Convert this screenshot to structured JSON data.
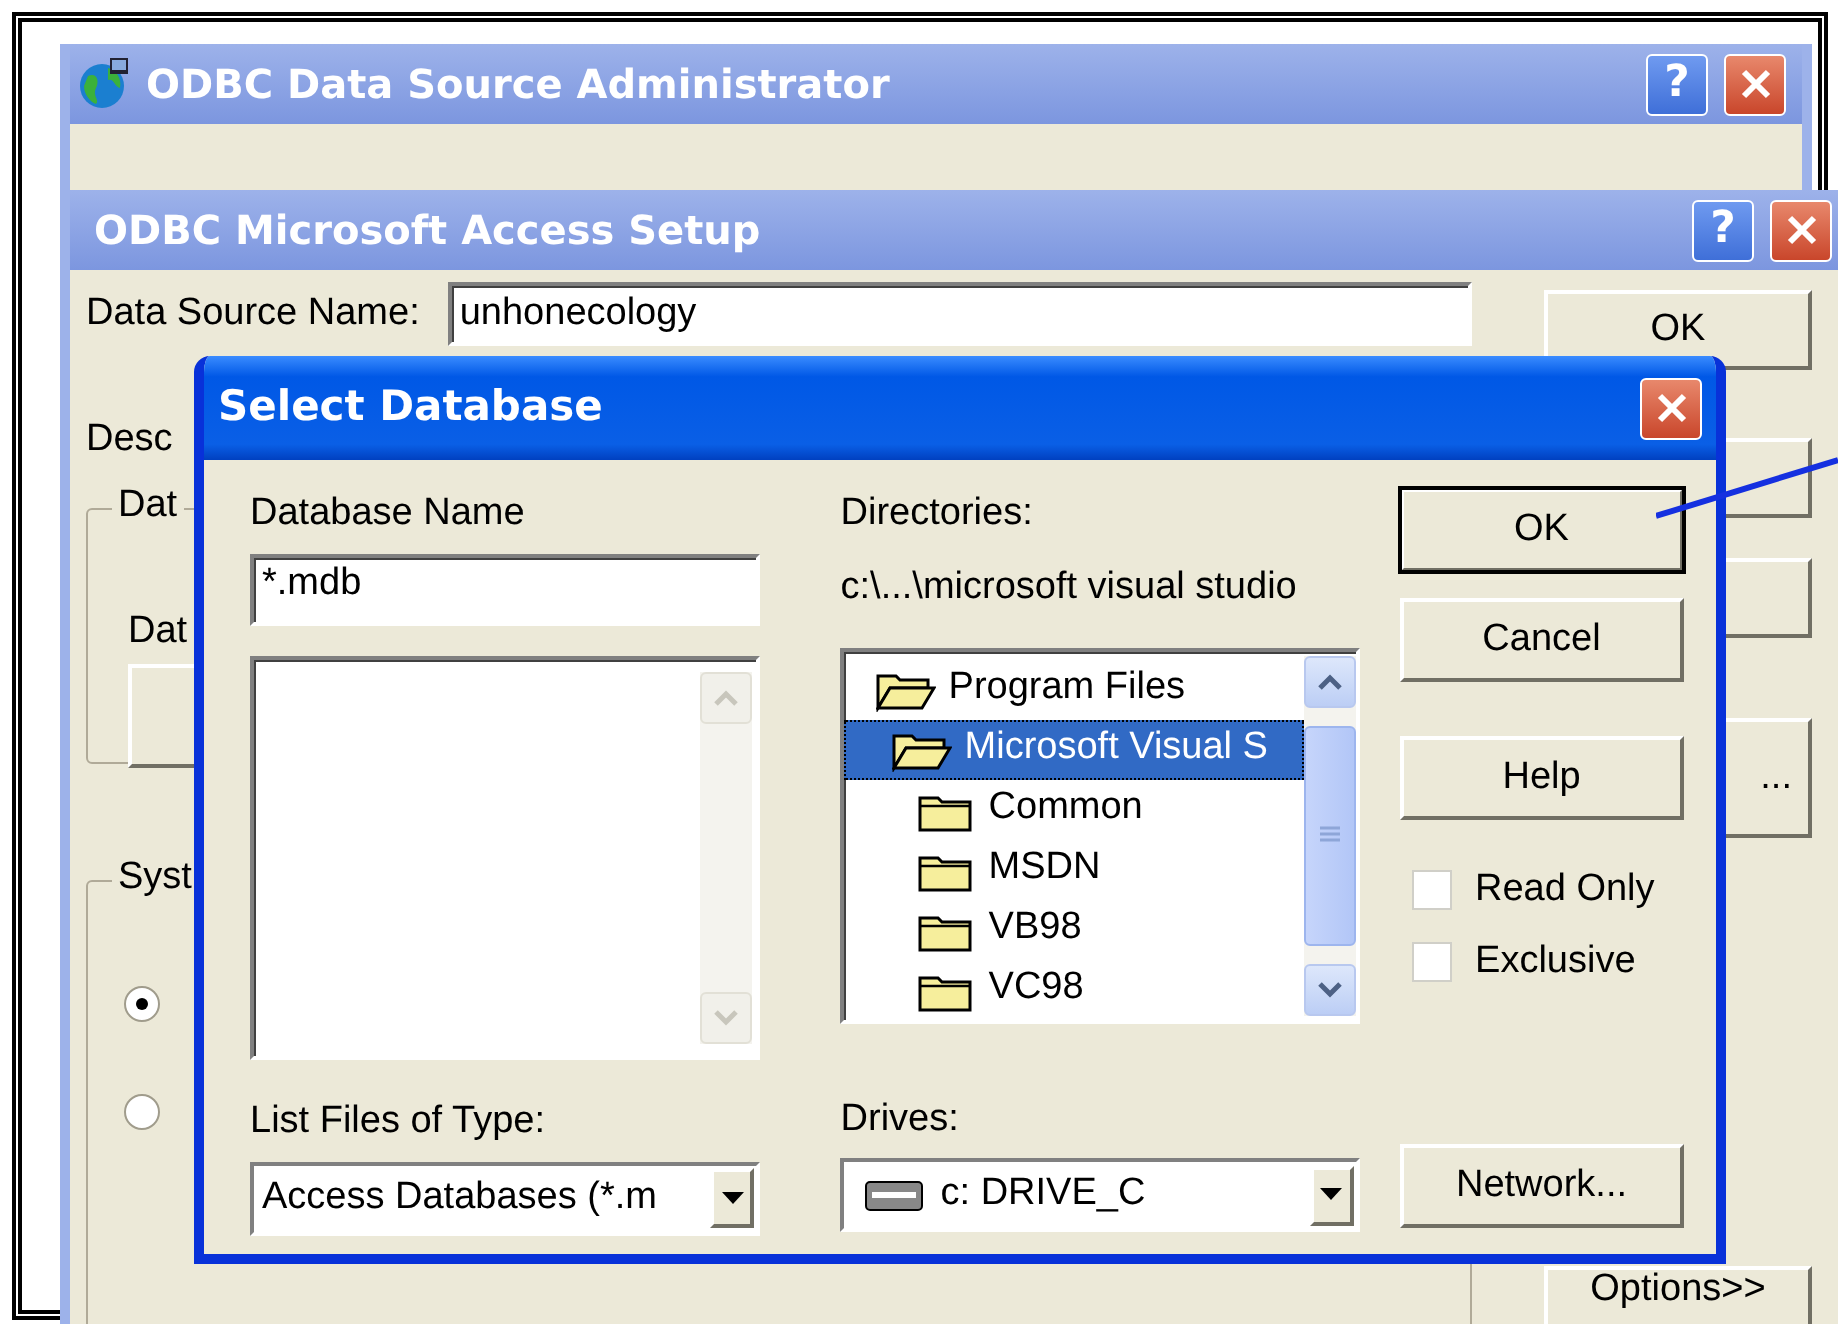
{
  "admin_window": {
    "title": "ODBC Data Source Administrator",
    "help_button": "?"
  },
  "setup_window": {
    "title": "ODBC Microsoft Access Setup",
    "help_button": "?",
    "data_source": {
      "label": "Data Source Name:",
      "value": "unhonecology"
    },
    "description_label": "Desc",
    "database_group": {
      "title": "Dat",
      "label": "Dat"
    },
    "system_group": {
      "title": "Syst",
      "radios": [
        {
          "selected": true
        },
        {
          "selected": false
        }
      ]
    },
    "buttons": [
      {
        "label": "OK"
      },
      {
        "label": "..."
      },
      {
        "label": "Options>>"
      }
    ]
  },
  "dialog": {
    "title": "Select Database",
    "database_name": {
      "label": "Database Name",
      "value": "*.mdb"
    },
    "file_type": {
      "label": "List Files of Type:",
      "value": "Access Databases (*.m"
    },
    "directories": {
      "label": "Directories:",
      "path": "c:\\...\\microsoft visual studio",
      "tree": [
        {
          "label": "Program Files",
          "selected": false,
          "children": [
            {
              "label": "Microsoft Visual S",
              "selected": true,
              "children": [
                {
                  "label": "Common",
                  "selected": false
                },
                {
                  "label": "MSDN",
                  "selected": false
                },
                {
                  "label": "VB98",
                  "selected": false
                },
                {
                  "label": "VC98",
                  "selected": false
                }
              ]
            }
          ]
        }
      ]
    },
    "drives": {
      "label": "Drives:",
      "value": "c: DRIVE_C"
    },
    "buttons": [
      {
        "label": "OK",
        "default": true
      },
      {
        "label": "Cancel",
        "default": false
      },
      {
        "label": "Help",
        "default": false
      }
    ],
    "options": [
      {
        "label": "Read Only",
        "checked": false
      },
      {
        "label": "Exclusive",
        "checked": false
      }
    ],
    "network_button": "Network..."
  }
}
